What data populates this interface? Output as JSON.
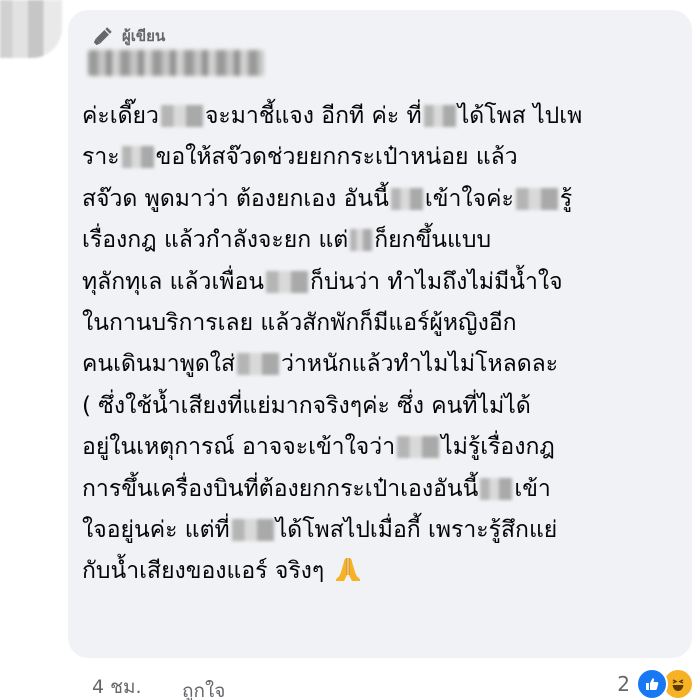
{
  "comment": {
    "author_badge": "ผู้เขียน",
    "lines": [
      [
        "ค่ะเดี๊ยว",
        "จะมาชี้แจง อีกที ค่ะ ที่",
        "ได้โพส ไปเพ"
      ],
      [
        "ราะ",
        "ขอให้สจ๊วดช่วยยกกระเป๋าหน่อย แล้ว"
      ],
      [
        "สจ๊วด พูดมาว่า ต้องยกเอง อันนี้",
        "เข้าใจค่ะ",
        "รู้"
      ],
      [
        "เรื่องกฎ แล้วกำลังจะยก แต่",
        "ก็ยกขึ้นแบบ"
      ],
      [
        "ทุลักทุเล แล้วเพื่อน",
        "ก็บ่นว่า ทำไมถึงไม่มีน้ำใจ"
      ],
      [
        "ในกานบริการเลย แล้วสักพักก็มีแอร์ผู้หญิงอีก"
      ],
      [
        "คนเดินมาพูดใส่",
        "ว่าหนักแล้วทำไมไม่โหลดละ"
      ],
      [
        "( ซึ่งใช้น้ำเสียงที่แย่มากจริงๆค่ะ ซึ่ง คนที่ไม่ได้"
      ],
      [
        "อยู่ในเหตุการณ์ อาจจะเข้าใจว่า",
        "ไม่รู้เรื่องกฎ"
      ],
      [
        "การขึ้นเครื่องบินที่ต้องยกกระเป๋าเองอันนี้",
        "เข้า"
      ],
      [
        "ใจอยู่นค่ะ แต่ที่",
        "ได้โพสไปเมื่อกี้ เพราะรู้สึกแย่"
      ],
      [
        "กับน้ำเสียงของแอร์ จริงๆ"
      ]
    ],
    "emoji_icon": "folded-hands-icon"
  },
  "footer": {
    "timestamp": "4 ชม.",
    "like_label": "ถูกใจ",
    "reaction_count": "2",
    "reaction_icons": [
      "like-icon",
      "haha-icon"
    ]
  },
  "colors": {
    "bubble_background": "#f0f2f5",
    "text": "#050505",
    "meta_text": "#65676b",
    "like_blue": "#1877f2",
    "haha_yellow": "#f7b125"
  }
}
